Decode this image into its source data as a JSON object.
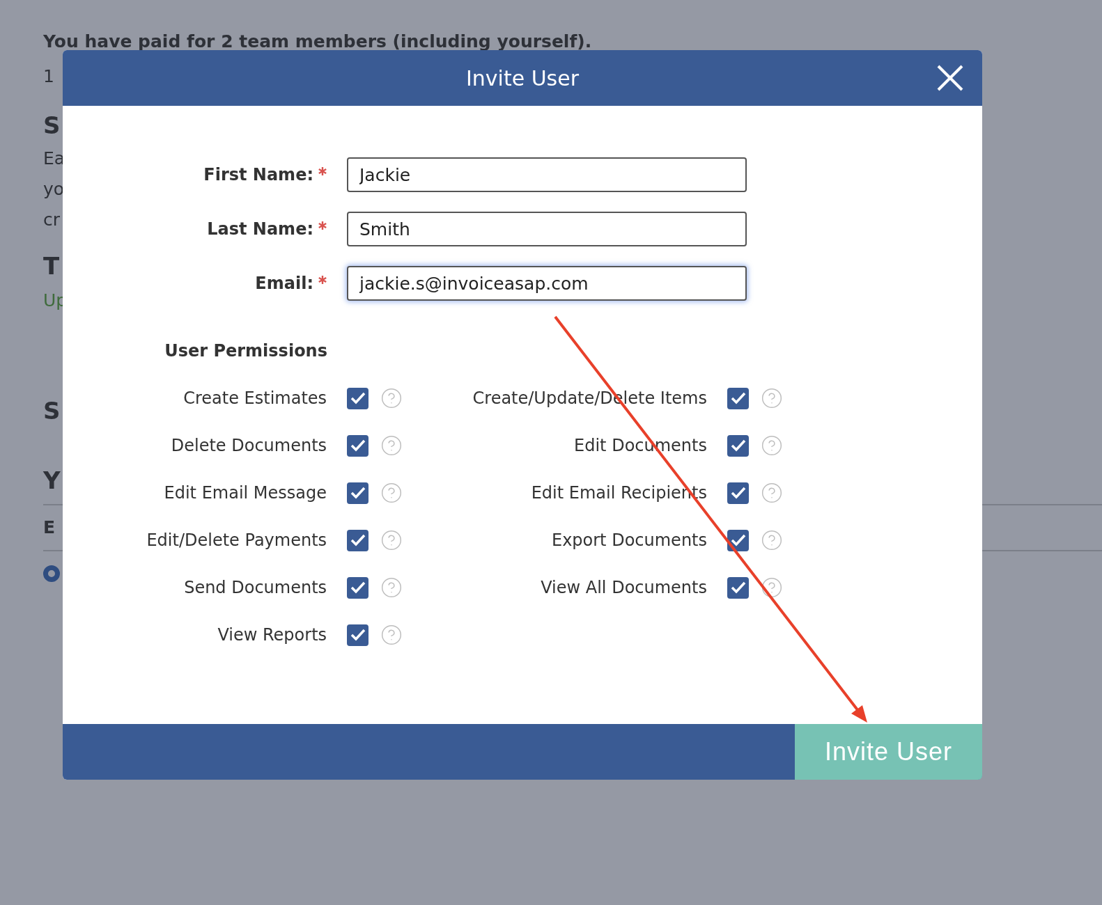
{
  "background_page": {
    "items": [
      {
        "kind": "text",
        "text": "You have paid for 2 team members (including yourself)."
      },
      {
        "kind": "text",
        "text": "1"
      },
      {
        "kind": "heading",
        "text": "S"
      },
      {
        "kind": "text",
        "text": "Ea"
      },
      {
        "kind": "text",
        "text": "yo"
      },
      {
        "kind": "text",
        "text": "cr"
      },
      {
        "kind": "heading",
        "text": "T"
      },
      {
        "kind": "link",
        "text": "Up"
      },
      {
        "kind": "heading",
        "text": "S"
      },
      {
        "kind": "heading",
        "text": "Y"
      },
      {
        "kind": "label",
        "text": "E"
      },
      {
        "kind": "radio",
        "selected": true
      }
    ]
  },
  "dialog": {
    "title": "Invite User",
    "fields": [
      {
        "label": "First Name:",
        "required": true,
        "value": "Jackie",
        "focused": false
      },
      {
        "label": "Last Name:",
        "required": true,
        "value": "Smith",
        "focused": false
      },
      {
        "label": "Email:",
        "required": true,
        "value": "jackie.s@invoiceasap.com",
        "focused": true
      }
    ],
    "permissions_title": "User Permissions",
    "permissions": [
      {
        "label": "Create Estimates",
        "checked": true
      },
      {
        "label": "Create/Update/Delete Items",
        "checked": true
      },
      {
        "label": "Delete Documents",
        "checked": true
      },
      {
        "label": "Edit Documents",
        "checked": true
      },
      {
        "label": "Edit Email Message",
        "checked": true
      },
      {
        "label": "Edit Email Recipients",
        "checked": true
      },
      {
        "label": "Edit/Delete Payments",
        "checked": true
      },
      {
        "label": "Export Documents",
        "checked": true
      },
      {
        "label": "Send Documents",
        "checked": true
      },
      {
        "label": "View All Documents",
        "checked": true
      },
      {
        "label": "View Reports",
        "checked": true
      }
    ],
    "submit_button": "Invite User"
  }
}
